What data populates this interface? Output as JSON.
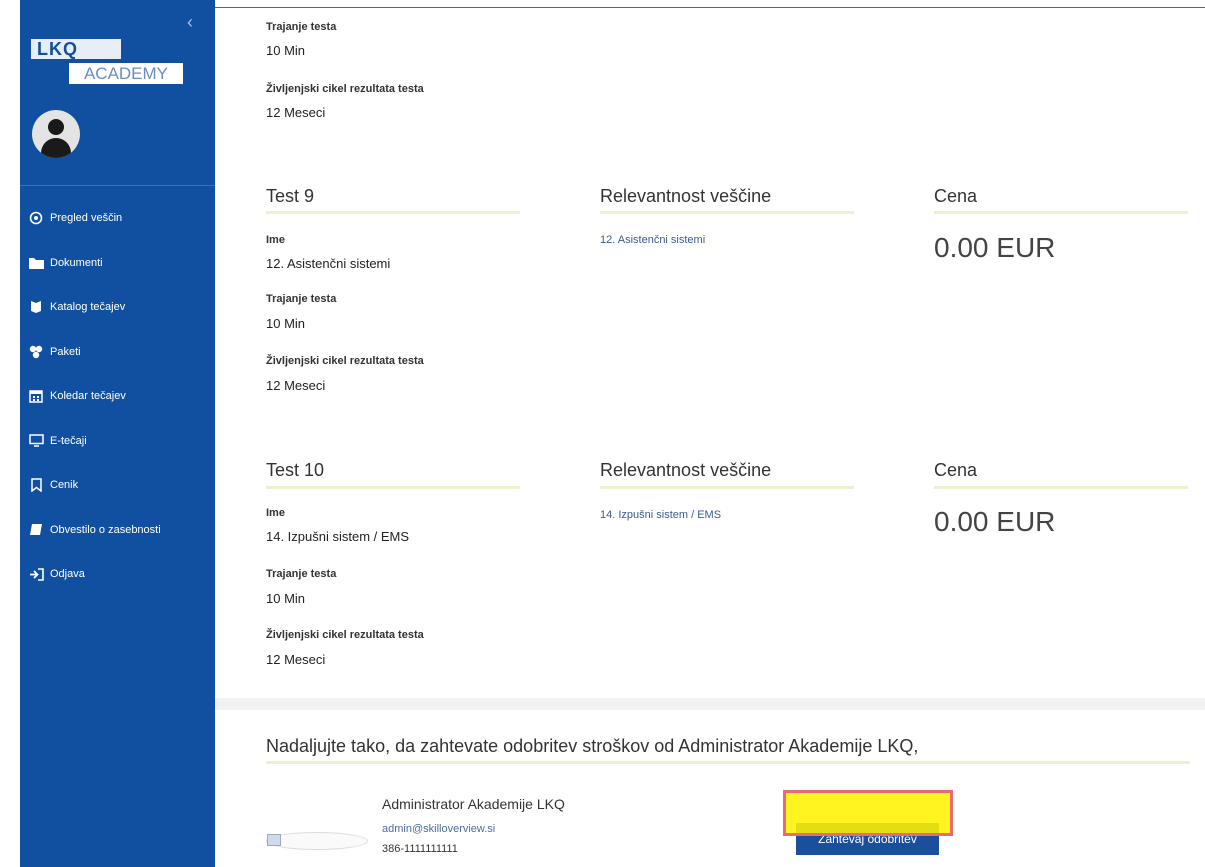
{
  "app": {
    "logo_top": "LKQ",
    "logo_bottom": "ACADEMY",
    "collapse_icon": "chevron-left-icon"
  },
  "sidebar": {
    "items": [
      {
        "label": "Pregled veščin",
        "icon": "skills-icon"
      },
      {
        "label": "Dokumenti",
        "icon": "folder-icon"
      },
      {
        "label": "Katalog tečajev",
        "icon": "book-icon"
      },
      {
        "label": "Paketi",
        "icon": "packages-icon"
      },
      {
        "label": "Koledar tečajev",
        "icon": "calendar-icon"
      },
      {
        "label": "E-tečaji",
        "icon": "monitor-icon"
      },
      {
        "label": "Cenik",
        "icon": "bookmark-icon"
      },
      {
        "label": "Obvestilo o zasebnosti",
        "icon": "privacy-icon"
      },
      {
        "label": "Odjava",
        "icon": "logout-icon"
      }
    ]
  },
  "partial_test": {
    "duration_label": "Trajanje testa",
    "duration_value": "10 Min",
    "lifecycle_label": "Življenjski cikel rezultata testa",
    "lifecycle_value": "12 Meseci"
  },
  "tests": [
    {
      "title": "Test 9",
      "name_label": "Ime",
      "name_value": "12. Asistenčni sistemi",
      "duration_label": "Trajanje testa",
      "duration_value": "10 Min",
      "lifecycle_label": "Življenjski cikel rezultata testa",
      "lifecycle_value": "12 Meseci",
      "relevance_heading": "Relevantnost veščine",
      "relevance_link": "12. Asistenčni sistemi",
      "price_heading": "Cena",
      "price": "0.00 EUR"
    },
    {
      "title": "Test 10",
      "name_label": "Ime",
      "name_value": "14. Izpušni sistem / EMS",
      "duration_label": "Trajanje testa",
      "duration_value": "10 Min",
      "lifecycle_label": "Življenjski cikel rezultata testa",
      "lifecycle_value": "12 Meseci",
      "relevance_heading": "Relevantnost veščine",
      "relevance_link": "14. Izpušni sistem / EMS",
      "price_heading": "Cena",
      "price": "0.00 EUR"
    }
  ],
  "approval": {
    "title": "Nadaljujte tako, da zahtevate odobritev stroškov od Administrator Akademije LKQ,",
    "admin_name": "Administrator Akademije LKQ",
    "admin_email": "admin@skilloverview.si",
    "admin_phone": "386-1111111111",
    "button_label": "Zahtevaj odobritev"
  },
  "colors": {
    "sidebar": "#1150a0",
    "button": "#1a4f9c",
    "highlight_fill": "#fff200",
    "highlight_border": "#e86a72"
  }
}
